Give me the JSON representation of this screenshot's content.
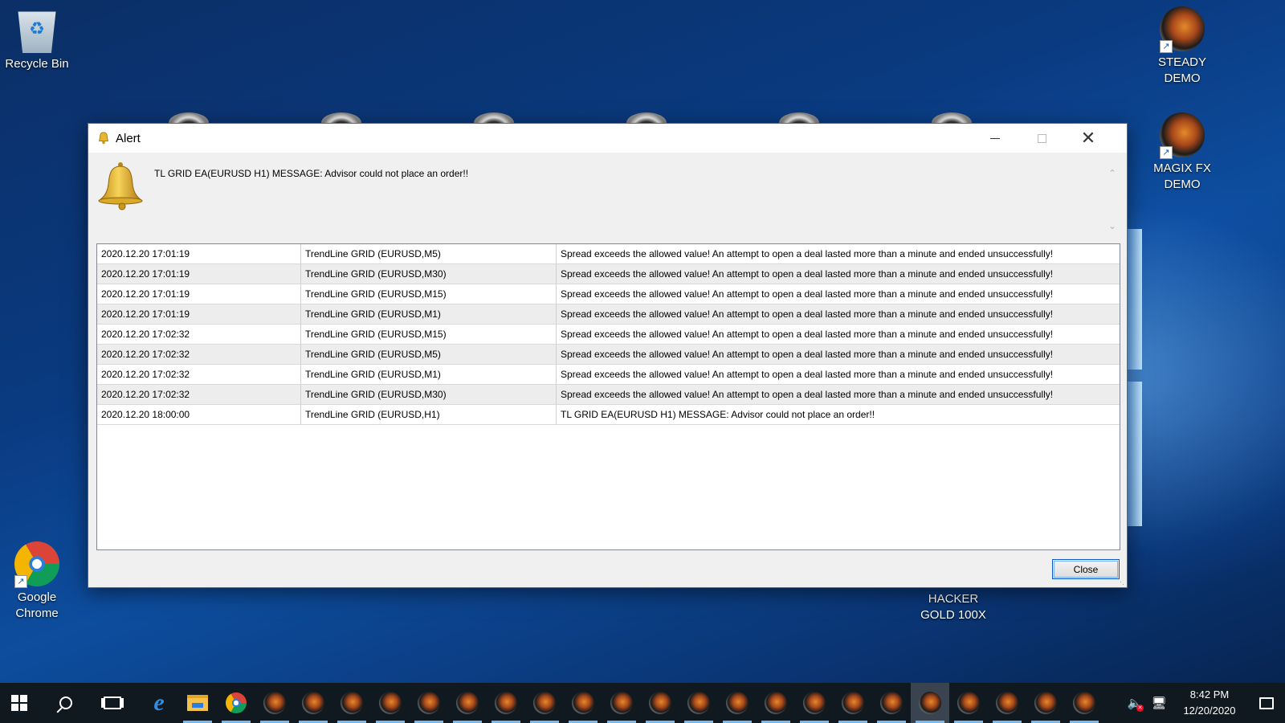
{
  "desktop": {
    "icons": [
      {
        "label": "Recycle Bin",
        "icon": "recycle-bin-icon"
      },
      {
        "label": "STEADY DEMO",
        "icon": "metatrader-icon"
      },
      {
        "label": "MAGIX FX DEMO",
        "icon": "metatrader-icon"
      },
      {
        "label": "Google Chrome",
        "icon": "chrome-icon"
      },
      {
        "label": "HACKER GOLD 100X",
        "icon": "metatrader-icon"
      }
    ]
  },
  "dialog": {
    "title": "Alert",
    "message": "TL GRID EA(EURUSD H1) MESSAGE: Advisor could not place an order!!",
    "close_label": "Close",
    "rows": [
      {
        "time": "2020.12.20 17:01:19",
        "source": "TrendLine GRID (EURUSD,M5)",
        "message": "Spread exceeds the allowed value! An attempt to open a deal lasted more than a minute and ended unsuccessfully!"
      },
      {
        "time": "2020.12.20 17:01:19",
        "source": "TrendLine GRID (EURUSD,M30)",
        "message": "Spread exceeds the allowed value! An attempt to open a deal lasted more than a minute and ended unsuccessfully!"
      },
      {
        "time": "2020.12.20 17:01:19",
        "source": "TrendLine GRID (EURUSD,M15)",
        "message": "Spread exceeds the allowed value! An attempt to open a deal lasted more than a minute and ended unsuccessfully!"
      },
      {
        "time": "2020.12.20 17:01:19",
        "source": "TrendLine GRID (EURUSD,M1)",
        "message": "Spread exceeds the allowed value! An attempt to open a deal lasted more than a minute and ended unsuccessfully!"
      },
      {
        "time": "2020.12.20 17:02:32",
        "source": "TrendLine GRID (EURUSD,M15)",
        "message": "Spread exceeds the allowed value! An attempt to open a deal lasted more than a minute and ended unsuccessfully!"
      },
      {
        "time": "2020.12.20 17:02:32",
        "source": "TrendLine GRID (EURUSD,M5)",
        "message": "Spread exceeds the allowed value! An attempt to open a deal lasted more than a minute and ended unsuccessfully!"
      },
      {
        "time": "2020.12.20 17:02:32",
        "source": "TrendLine GRID (EURUSD,M1)",
        "message": "Spread exceeds the allowed value! An attempt to open a deal lasted more than a minute and ended unsuccessfully!"
      },
      {
        "time": "2020.12.20 17:02:32",
        "source": "TrendLine GRID (EURUSD,M30)",
        "message": "Spread exceeds the allowed value! An attempt to open a deal lasted more than a minute and ended unsuccessfully!"
      },
      {
        "time": "2020.12.20 18:00:00",
        "source": "TrendLine GRID (EURUSD,H1)",
        "message": "TL GRID EA(EURUSD H1) MESSAGE: Advisor could not place an order!!"
      }
    ]
  },
  "taskbar": {
    "pinned": [
      "start-icon",
      "search-icon",
      "task-view-icon",
      "internet-explorer-icon",
      "file-explorer-icon",
      "chrome-icon"
    ],
    "metatrader_window_count": 22,
    "selected_metatrader_index": 17,
    "clock": {
      "time": "8:42 PM",
      "date": "12/20/2020"
    }
  },
  "colors": {
    "accent": "#1f75d1",
    "taskbar": "#101820",
    "row_alt": "#ededed"
  }
}
